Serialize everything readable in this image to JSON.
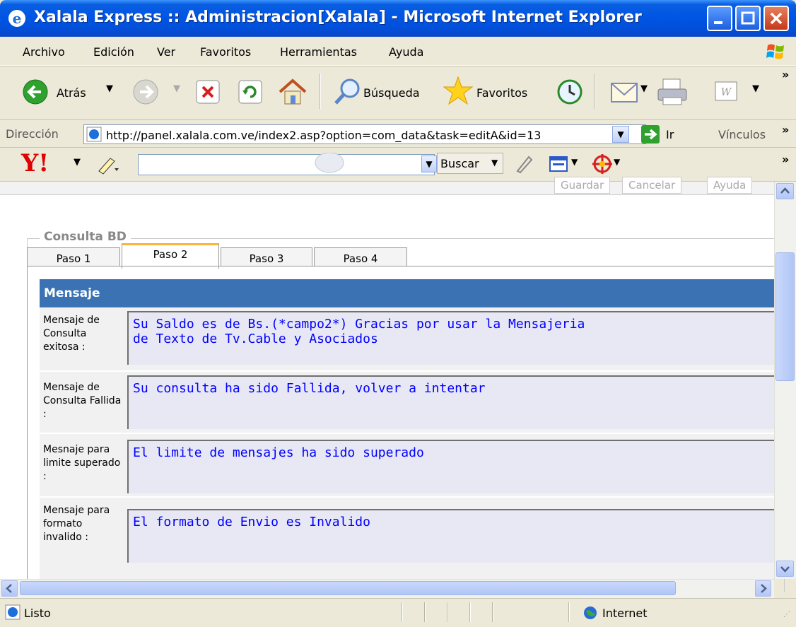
{
  "window": {
    "title": "Xalala Express :: Administracion[Xalala] - Microsoft Internet Explorer"
  },
  "menu": [
    "Archivo",
    "Edición",
    "Ver",
    "Favoritos",
    "Herramientas",
    "Ayuda"
  ],
  "toolbar": {
    "back_label": "Atrás",
    "search_label": "Búsqueda",
    "favorites_label": "Favoritos",
    "chevron": "»"
  },
  "address": {
    "label": "Dirección",
    "url": "http://panel.xalala.com.ve/index2.asp?option=com_data&task=editA&id=13",
    "go_label": "Ir",
    "links_label": "Vínculos",
    "chevron": "»"
  },
  "yahoo": {
    "logo": "Y!",
    "search_button": "Buscar",
    "chevron": "»"
  },
  "page": {
    "top_buttons": [
      "Guardar",
      "Cancelar",
      "Ayuda"
    ],
    "legend": "Consulta BD",
    "tabs": [
      "Paso 1",
      "Paso 2",
      "Paso 3",
      "Paso 4"
    ],
    "active_tab": "Paso 2",
    "section_title": "Mensaje",
    "rows": [
      {
        "label": "Mensaje de Consulta exitosa :",
        "value": "Su Saldo es de Bs.(*campo2*) Gracias por usar la Mensajeria\nde Texto de Tv.Cable y Asociados"
      },
      {
        "label": "Mensaje de Consulta Fallida :",
        "value": "Su consulta ha sido Fallida, volver a intentar"
      },
      {
        "label": "Mesnaje para limite superado :",
        "value": "El limite de mensajes ha sido superado"
      },
      {
        "label": "Mensaje para formato invalido :",
        "value": "El formato de Envio es Invalido"
      }
    ]
  },
  "status": {
    "text": "Listo",
    "zone": "Internet"
  },
  "colors": {
    "titlebar": "#0055E5",
    "section_header": "#3B72B3",
    "message_text": "#0000FF",
    "active_tab_accent": "#F7B53B"
  }
}
